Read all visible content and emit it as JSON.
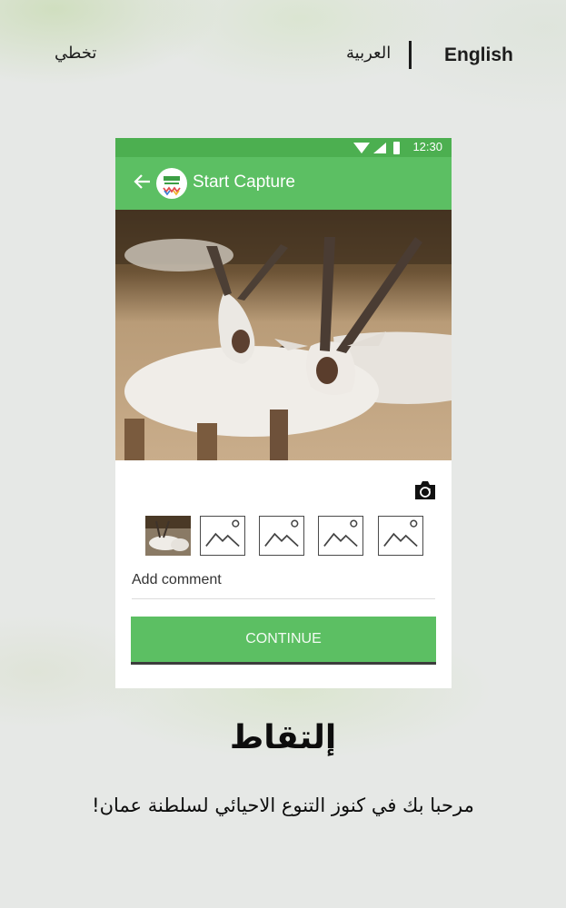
{
  "header": {
    "english_label": "English",
    "arabic_label": "العربية",
    "skip_label": "تخطي"
  },
  "phone": {
    "status_time": "12:30",
    "app_title": "Start Capture",
    "comment_placeholder": "Add comment",
    "continue_label": "CONTINUE",
    "accent_color": "#5cbf63",
    "thumbnails": [
      "captured-photo",
      "empty",
      "empty",
      "empty",
      "empty"
    ]
  },
  "headline": "إلتقاط",
  "welcome_text": "مرحبا بك في كنوز التنوع الاحيائي لسلطنة عمان!"
}
